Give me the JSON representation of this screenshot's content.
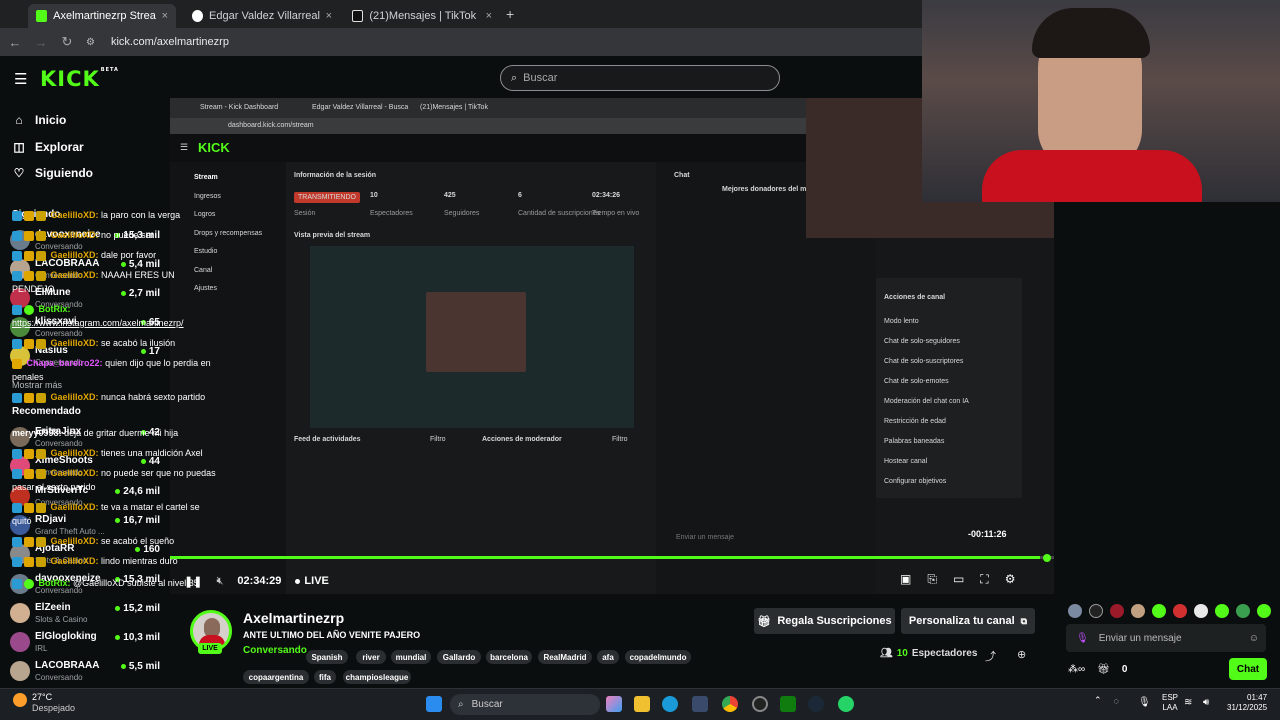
{
  "browser": {
    "tabs": [
      {
        "label": "Axelmartinezrp Stream - Watc",
        "close": "×"
      },
      {
        "label": "Edgar Valdez Villarreal - Buscar",
        "close": "×"
      },
      {
        "label": "(21)Mensajes | TikTok",
        "close": "×"
      }
    ],
    "new_tab": "+",
    "url": "kick.com/axelmartinezrp",
    "back": "←",
    "forward": "→",
    "reload": "↻"
  },
  "header": {
    "logo": "KICK",
    "logo_beta": "BETA",
    "search_placeholder": "Buscar"
  },
  "sidebar": {
    "nav": [
      {
        "label": "Inicio",
        "icon": "home-icon"
      },
      {
        "label": "Explorar",
        "icon": "compass-icon"
      },
      {
        "label": "Siguiendo",
        "icon": "heart-icon"
      }
    ],
    "following_title": "Siguiendo",
    "following": [
      {
        "name": "davooxeneize",
        "category": "Conversando",
        "viewers": "15,3 mil",
        "color": "#6a7b8c"
      },
      {
        "name": "LACOBRAAA",
        "category": "Conversando",
        "viewers": "5,4 mil",
        "color": "#b8a590"
      },
      {
        "name": "ElMune",
        "category": "Conversando",
        "viewers": "2,7 mil",
        "color": "#c0304a"
      },
      {
        "name": "klissxavi",
        "category": "Conversando",
        "viewers": "65",
        "color": "#4a8a3a"
      },
      {
        "name": "Nasius",
        "category": "Conversando",
        "viewers": "17",
        "color": "#d8c23a"
      }
    ],
    "show_more": "Mostrar más",
    "recommended_title": "Recomendado",
    "recommended": [
      {
        "name": "EritraJinx",
        "category": "Conversando",
        "viewers": "42",
        "color": "#7a6a5a"
      },
      {
        "name": "XimeShoots",
        "category": "Conversando",
        "viewers": "44",
        "color": "#e04a7a"
      },
      {
        "name": "MrStivenTc",
        "category": "Conversando",
        "viewers": "24,6 mil",
        "color": "#c03020"
      },
      {
        "name": "RDjavi",
        "category": "Grand Theft Auto ...",
        "viewers": "16,7 mil",
        "color": "#3a5a9a"
      },
      {
        "name": "AjotaRR",
        "category": "Slots & Casino",
        "viewers": "160",
        "color": "#8a8a8a"
      },
      {
        "name": "davooxeneize",
        "category": "Conversando",
        "viewers": "15,3 mil",
        "color": "#6a7b8c"
      },
      {
        "name": "ElZeein",
        "category": "Slots & Casino",
        "viewers": "15,2 mil",
        "color": "#d0b090"
      },
      {
        "name": "ElGlogloking",
        "category": "IRL",
        "viewers": "10,3 mil",
        "color": "#9a4a8a"
      },
      {
        "name": "LACOBRAAA",
        "category": "Conversando",
        "viewers": "5,5 mil",
        "color": "#b8a590"
      }
    ]
  },
  "video": {
    "remaining": "-00:11:26",
    "time": "02:34:29",
    "live_label": "LIVE",
    "inner": {
      "tabs": [
        "Stream - Kick Dashboard",
        "Edgar Valdez Villarreal - Busca",
        "(21)Mensajes | TikTok"
      ],
      "url": "dashboard.kick.com/stream",
      "logo": "KICK",
      "menu": [
        "Stream",
        "Ingresos",
        "Logros",
        "Drops y recompensas",
        "Estudio",
        "Canal",
        "Ajustes"
      ],
      "session_title": "Información de la sesión",
      "status": "TRANSMITIENDO",
      "stats": [
        {
          "value": "10",
          "label": "Espectadores"
        },
        {
          "value": "425",
          "label": "Seguidores"
        },
        {
          "value": "6",
          "label": "Cantidad de suscripciones"
        },
        {
          "value": "02:34:26",
          "label": "Tiempo en vivo"
        }
      ],
      "stat_session": "Sesión",
      "preview_title": "Vista previa del stream",
      "feed_title": "Feed de actividades",
      "feed_filter": "Filtro",
      "mod_title": "Acciones de moderador",
      "mod_filter": "Filtro",
      "chat_title": "Chat",
      "donors_title": "Mejores donadores del me",
      "channel_actions": "Acciones de canal",
      "channel_options": [
        "Modo lento",
        "Chat de solo-seguidores",
        "Chat de solo-suscriptores",
        "Chat de solo-emotes",
        "Moderación del chat con IA",
        "Restricción de edad",
        "Palabras baneadas",
        "Hostear canal",
        "Configurar objetivos"
      ],
      "send_placeholder": "Enviar un mensaje"
    }
  },
  "chat": {
    "messages": [
      {
        "user": "GaelilloXD:",
        "text": "la paro con la verga",
        "color": "gold",
        "badges": [
          "blue",
          "gold",
          "gift"
        ]
      },
      {
        "user": "GaelilloXD:",
        "text": "no puede ser",
        "color": "gold",
        "badges": [
          "blue",
          "gold",
          "gift"
        ]
      },
      {
        "user": "GaelilloXD:",
        "text": "dale por favor",
        "color": "gold",
        "badges": [
          "blue",
          "gold",
          "gift"
        ]
      },
      {
        "user": "GaelilloXD:",
        "text": "NAAAH ERES UN PENDEJO",
        "color": "gold",
        "badges": [
          "blue",
          "gold",
          "gift"
        ]
      },
      {
        "user": "BotRix:",
        "text": "https://www.instagram.com/axelmartinezrp/",
        "color": "green",
        "badges": [
          "blue",
          "green"
        ]
      },
      {
        "user": "GaelilloXD:",
        "text": "se acabó la ilusión",
        "color": "gold",
        "badges": [
          "blue",
          "gold",
          "gift"
        ]
      },
      {
        "user": "Chapa_bareiro22:",
        "text": "quien dijo que lo perdia en penales",
        "color": "pink",
        "badges": [
          "gold"
        ]
      },
      {
        "user": "GaelilloXD:",
        "text": "nunca habrá sexto partido",
        "color": "gold",
        "badges": [
          "blue",
          "gold",
          "gift"
        ]
      },
      {
        "user": "meryy0998:",
        "text": "deja de gritar duerme mi hija",
        "color": "white",
        "badges": []
      },
      {
        "user": "GaelilloXD:",
        "text": "tienes una maldición Axel",
        "color": "gold",
        "badges": [
          "blue",
          "gold",
          "gift"
        ]
      },
      {
        "user": "GaelilloXD:",
        "text": "no puede ser que no puedas pasar al sexto parido",
        "color": "gold",
        "badges": [
          "blue",
          "gold",
          "gift"
        ]
      },
      {
        "user": "GaelilloXD:",
        "text": "te va a matar el cartel se quitó",
        "color": "gold",
        "badges": [
          "blue",
          "gold",
          "gift"
        ]
      },
      {
        "user": "GaelilloXD:",
        "text": "se acabó el sueño",
        "color": "gold",
        "badges": [
          "blue",
          "gold",
          "gift"
        ]
      },
      {
        "user": "GaelilloXD:",
        "text": "lindo mientras duro",
        "color": "gold",
        "badges": [
          "blue",
          "gold",
          "gift"
        ]
      },
      {
        "user": "BotRix:",
        "text": "@GaelilloXD subiste al nivel 35",
        "color": "green",
        "badges": [
          "blue",
          "green"
        ]
      }
    ],
    "input_placeholder": "Enviar un mensaje",
    "footer_count": "0",
    "send_label": "Chat"
  },
  "stream": {
    "streamer": "Axelmartinezrp",
    "title": "ANTE ULTIMO DEL AÑO VENITE PAJERO",
    "category": "Conversando",
    "tags": [
      "Spanish",
      "river",
      "mundial",
      "Gallardo",
      "barcelona",
      "RealMadrid",
      "afa",
      "copadelmundo",
      "copaargentina",
      "fifa",
      "champiosleague"
    ],
    "live": "LIVE",
    "gift_button": "Regala Suscripciones",
    "personalize_button": "Personaliza tu canal",
    "viewers_count": "10",
    "viewers_label": "Espectadores"
  },
  "taskbar": {
    "temperature": "27°C",
    "weather": "Despejado",
    "search": "Buscar",
    "lang_top": "ESP",
    "lang_bottom": "LAA",
    "time": "01:47",
    "date": "31/12/2025"
  },
  "colors": {
    "accent": "#53fc18",
    "background": "#0b0e0f"
  }
}
